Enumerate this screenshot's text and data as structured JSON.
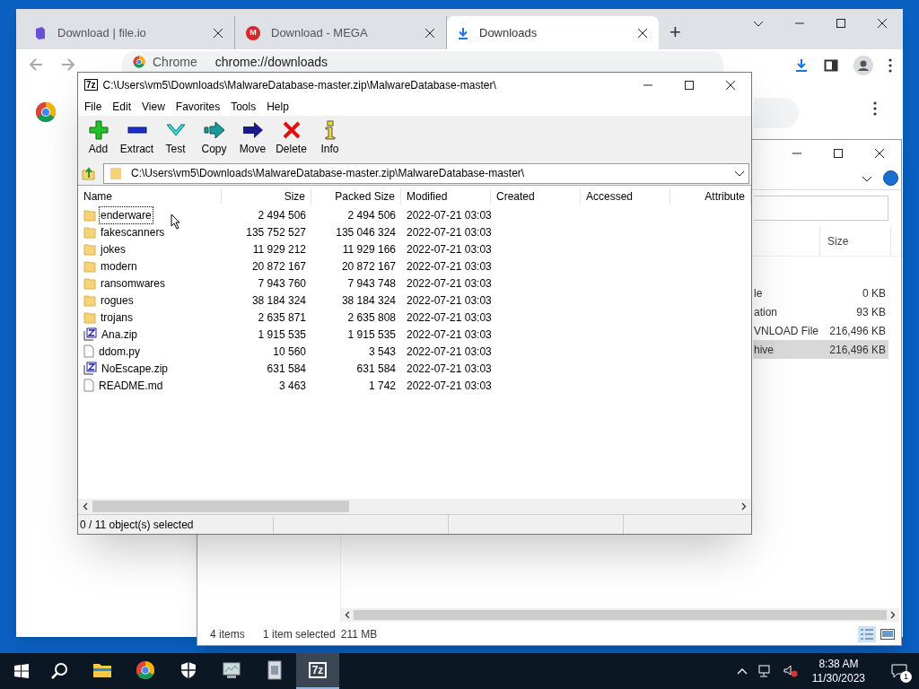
{
  "chrome": {
    "tabs": [
      {
        "label": "Download | file.io",
        "kind": "cube",
        "selected": false
      },
      {
        "label": "Download - MEGA",
        "kind": "badge",
        "icon_text": "M",
        "selected": false
      },
      {
        "label": "Downloads",
        "kind": "download",
        "selected": true
      }
    ],
    "new_tab": "+",
    "address": {
      "origin": "Chrome",
      "url": "chrome://downloads"
    }
  },
  "explorer": {
    "columns": [
      "Size"
    ],
    "rows": [
      {
        "name": "le",
        "size": "0 KB",
        "selected": false
      },
      {
        "name": "ation",
        "size": "93 KB",
        "selected": false
      },
      {
        "name": "VNLOAD File",
        "size": "216,496 KB",
        "selected": false
      },
      {
        "name": "hive",
        "size": "216,496 KB",
        "selected": true
      }
    ],
    "status": {
      "count": "4 items",
      "selection": "1 item selected",
      "size": "211 MB"
    }
  },
  "sevenzip": {
    "icon_text": "7z",
    "title": "C:\\Users\\vm5\\Downloads\\MalwareDatabase-master.zip\\MalwareDatabase-master\\",
    "menu": [
      "File",
      "Edit",
      "View",
      "Favorites",
      "Tools",
      "Help"
    ],
    "toolbar": [
      {
        "label": "Add",
        "kind": "add"
      },
      {
        "label": "Extract",
        "kind": "extract"
      },
      {
        "label": "Test",
        "kind": "test"
      },
      {
        "label": "Copy",
        "kind": "copy"
      },
      {
        "label": "Move",
        "kind": "move"
      },
      {
        "label": "Delete",
        "kind": "delete"
      },
      {
        "label": "Info",
        "kind": "info"
      }
    ],
    "path": "C:\\Users\\vm5\\Downloads\\MalwareDatabase-master.zip\\MalwareDatabase-master\\",
    "columns": [
      "Name",
      "Size",
      "Packed Size",
      "Modified",
      "Created",
      "Accessed",
      "Attribute"
    ],
    "rows": [
      {
        "kind": "folder",
        "name": "enderware",
        "size": "2 494 506",
        "packed": "2 494 506",
        "modified": "2022-07-21 03:03",
        "focused": true
      },
      {
        "kind": "folder",
        "name": "fakescanners",
        "size": "135 752 527",
        "packed": "135 046 324",
        "modified": "2022-07-21 03:03",
        "focused": false
      },
      {
        "kind": "folder",
        "name": "jokes",
        "size": "11 929 212",
        "packed": "11 929 166",
        "modified": "2022-07-21 03:03",
        "focused": false
      },
      {
        "kind": "folder",
        "name": "modern",
        "size": "20 872 167",
        "packed": "20 872 167",
        "modified": "2022-07-21 03:03",
        "focused": false
      },
      {
        "kind": "folder",
        "name": "ransomwares",
        "size": "7 943 760",
        "packed": "7 943 748",
        "modified": "2022-07-21 03:03",
        "focused": false
      },
      {
        "kind": "folder",
        "name": "rogues",
        "size": "38 184 324",
        "packed": "38 184 324",
        "modified": "2022-07-21 03:03",
        "focused": false
      },
      {
        "kind": "folder",
        "name": "trojans",
        "size": "2 635 871",
        "packed": "2 635 808",
        "modified": "2022-07-21 03:03",
        "focused": false
      },
      {
        "kind": "zip",
        "name": "Ana.zip",
        "size": "1 915 535",
        "packed": "1 915 535",
        "modified": "2022-07-21 03:03",
        "focused": false
      },
      {
        "kind": "file",
        "name": "ddom.py",
        "size": "10 560",
        "packed": "3 543",
        "modified": "2022-07-21 03:03",
        "focused": false
      },
      {
        "kind": "zip",
        "name": "NoEscape.zip",
        "size": "631 584",
        "packed": "631 584",
        "modified": "2022-07-21 03:03",
        "focused": false
      },
      {
        "kind": "file",
        "name": "README.md",
        "size": "3 463",
        "packed": "1 742",
        "modified": "2022-07-21 03:03",
        "focused": false
      }
    ],
    "status": "0 / 11 object(s) selected"
  },
  "taskbar": {
    "apps": [
      {
        "kind": "files",
        "active": false
      },
      {
        "kind": "chrome",
        "active": false
      },
      {
        "kind": "security",
        "active": false
      },
      {
        "kind": "monitor",
        "active": false
      },
      {
        "kind": "installer",
        "active": false
      },
      {
        "kind": "archiver",
        "label": "7z",
        "active": true
      }
    ],
    "time": "8:38 AM",
    "date": "11/30/2023",
    "notifications": "1"
  }
}
